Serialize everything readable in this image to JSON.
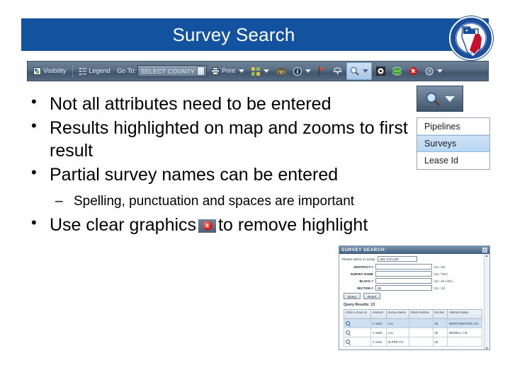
{
  "header": {
    "title": "Survey Search",
    "seal_alt": "Railroad Commission of Texas seal",
    "bar_color": "#12529E"
  },
  "toolbar": {
    "visibility_label": "Visibility",
    "legend_label": "Legend",
    "goto_label": "Go To:",
    "county_value": "SELECT COUNTY",
    "print_label": "Print"
  },
  "search_dropdown": {
    "options": [
      {
        "label": "Pipelines",
        "selected": false
      },
      {
        "label": "Surveys",
        "selected": true
      },
      {
        "label": "Lease Id",
        "selected": false
      }
    ]
  },
  "bullets": [
    {
      "level": 1,
      "text": "Not all attributes need to be entered"
    },
    {
      "level": 1,
      "text": "Results highlighted on map and zooms to first result"
    },
    {
      "level": 1,
      "text": "Partial survey names can be entered"
    },
    {
      "level": 2,
      "text": "Spelling, punctuation and spaces are important"
    }
  ],
  "last_bullet": {
    "text_before": "Use clear graphics",
    "text_after": "to remove highlight",
    "icon_glyph": "x"
  },
  "survey_panel": {
    "title": "SURVEY SEARCH:",
    "minimize_glyph": "□",
    "county_label": "Please select a county:",
    "county_value": "481 TAYLOR",
    "fields": [
      {
        "label": "ABSTRACT #",
        "value": "",
        "hint": "(Ex: 36)"
      },
      {
        "label": "SURVEY NAME",
        "value": "",
        "hint": "(Ex: T&P)"
      },
      {
        "label": "BLOCK #",
        "value": "",
        "hint": "(Ex: 48 1/4N)"
      },
      {
        "label": "SECTION #",
        "value": "25",
        "hint": "(Ex: 19)"
      }
    ],
    "query_button": "Query",
    "reset_button": "Reset",
    "results_label": "Query Results:",
    "results_count": "13",
    "columns": [
      "Click to Zoom to",
      "Abstract",
      "Survey Name",
      "Block Number",
      "Section",
      "Abstract Name"
    ],
    "rows": [
      {
        "zoom": "⌕",
        "abstract": "A-1651",
        "survey": "LAL",
        "block": "",
        "section": "25",
        "name": "WORTHINGTON J M",
        "highlight": true
      },
      {
        "zoom": "⌕",
        "abstract": "A-1655",
        "survey": "LAL",
        "block": "",
        "section": "25",
        "name": "NEWELL J M",
        "highlight": false
      },
      {
        "zoom": "⌕",
        "abstract": "A-1261",
        "survey": "W PRR CO",
        "block": "",
        "section": "25",
        "name": "",
        "highlight": false
      }
    ]
  }
}
